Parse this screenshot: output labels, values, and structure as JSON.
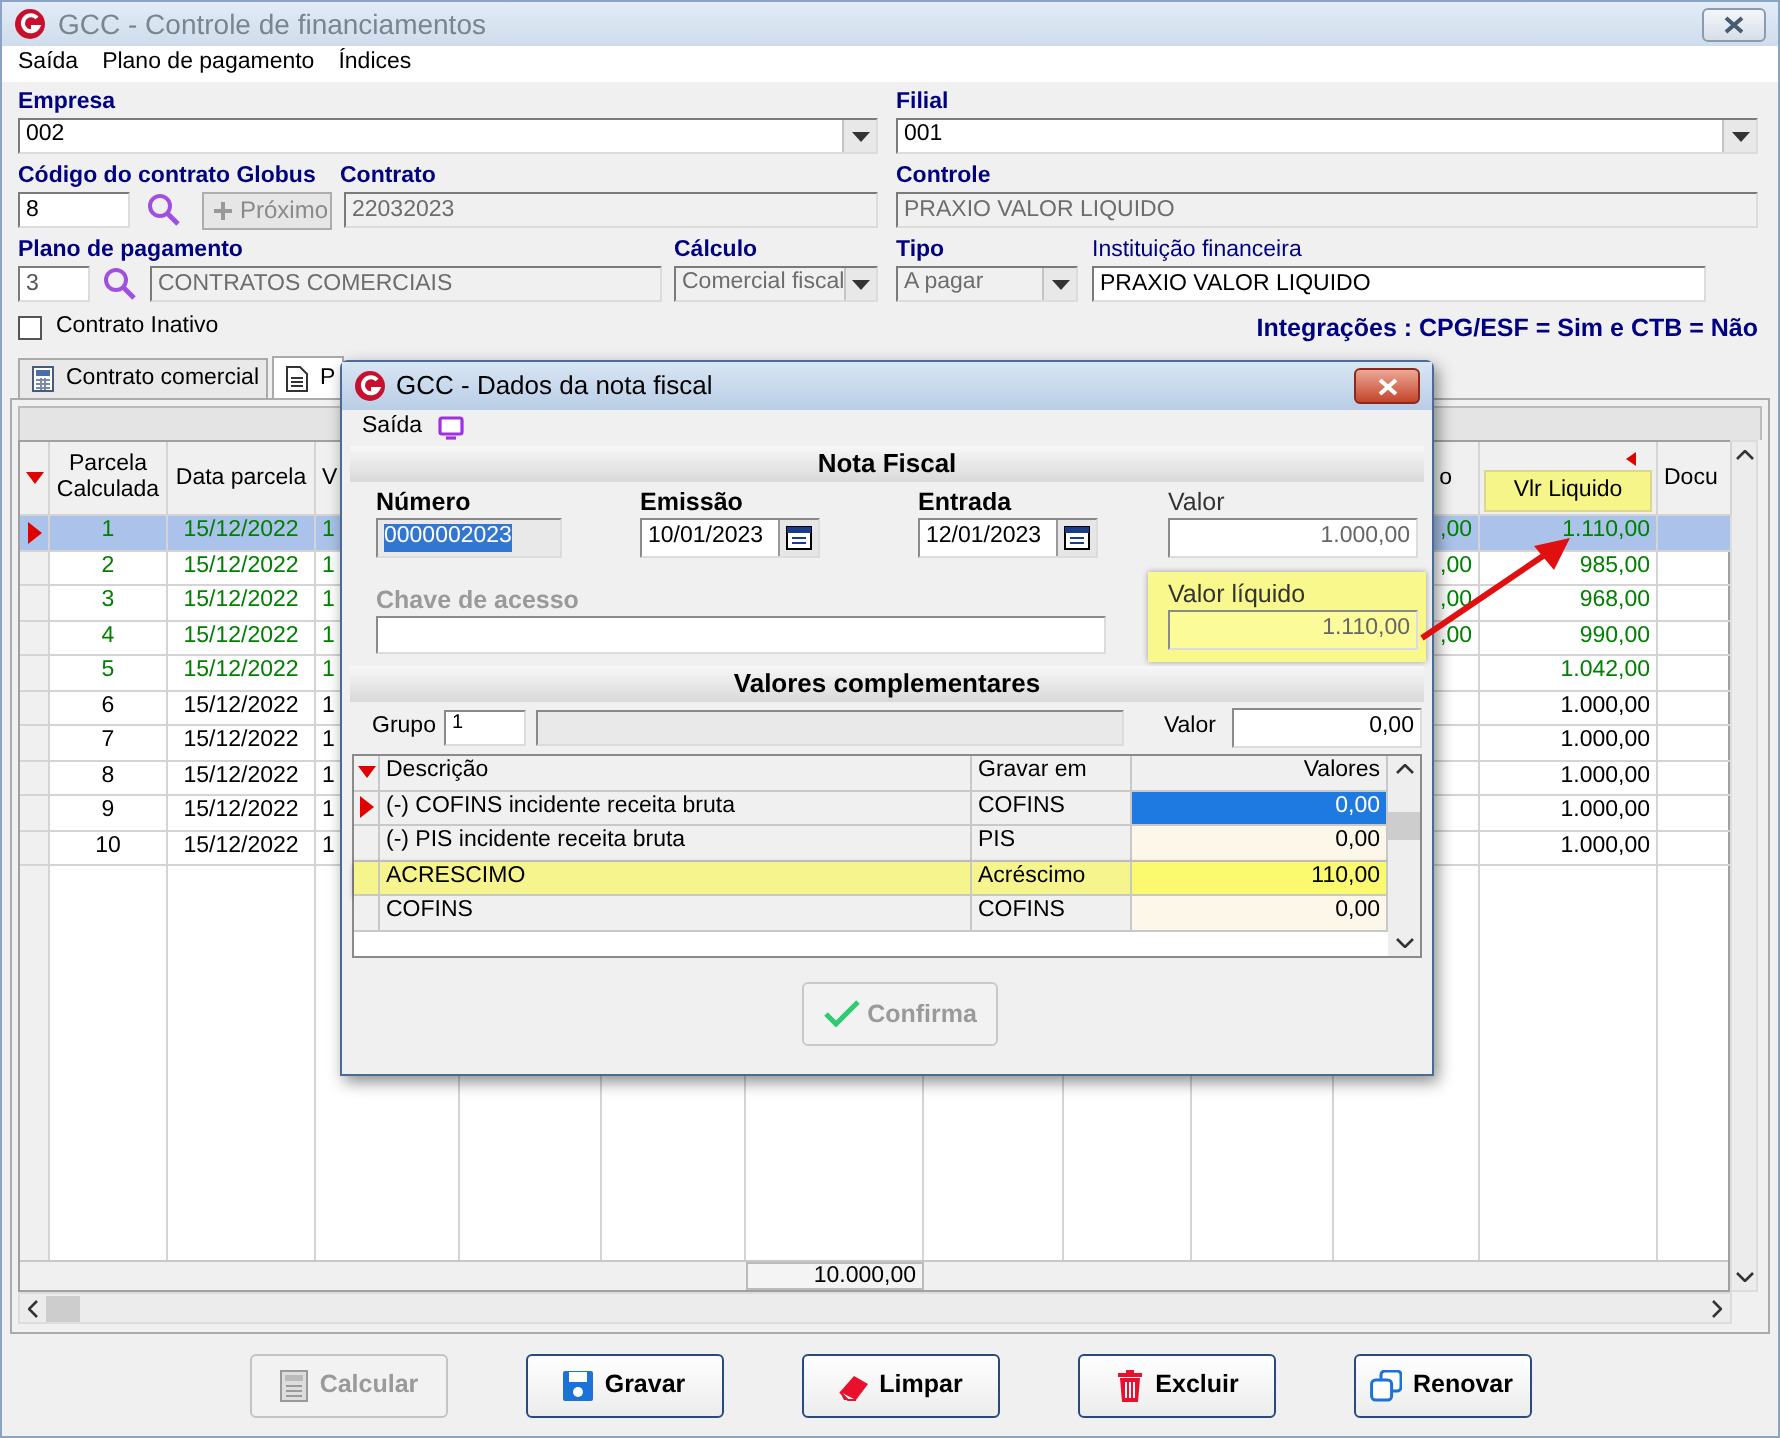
{
  "window": {
    "title": "GCC - Controle de financiamentos"
  },
  "menu": [
    "Saída",
    "Plano de pagamento",
    "Índices"
  ],
  "form": {
    "empresa": {
      "label": "Empresa",
      "value": "002"
    },
    "filial": {
      "label": "Filial",
      "value": "001"
    },
    "codigo": {
      "label": "Código do contrato Globus",
      "value": "8"
    },
    "proximo_button": {
      "label": "Próximo",
      "disabled": true
    },
    "contrato": {
      "label": "Contrato",
      "value": "22032023"
    },
    "controle": {
      "label": "Controle",
      "value": "PRAXIO VALOR LIQUIDO"
    },
    "plano": {
      "label": "Plano de pagamento",
      "code": "3",
      "value": "CONTRATOS COMERCIAIS"
    },
    "calculo": {
      "label": "Cálculo",
      "value": "Comercial fiscal",
      "disabled": true
    },
    "tipo": {
      "label": "Tipo",
      "value": "A pagar",
      "disabled": true
    },
    "instituicao": {
      "label": "Instituição financeira",
      "value": "PRAXIO VALOR LIQUIDO"
    },
    "contrato_inativo": {
      "label": "Contrato Inativo",
      "checked": false
    },
    "integracoes": "Integrações : CPG/ESF = Sim e CTB = Não"
  },
  "tabs": [
    {
      "label": "Contrato comercial",
      "selected": false
    },
    {
      "label": "P",
      "selected": true
    }
  ],
  "grid": {
    "columns": [
      {
        "label": "Parcela Calculada",
        "highlighted": false
      },
      {
        "label": "Data parcela",
        "highlighted": false
      },
      {
        "label": "V",
        "highlighted": false
      },
      {
        "label": "o",
        "highlighted": false
      },
      {
        "label": "Vlr Liquido",
        "highlighted": true
      },
      {
        "label": "Docu",
        "highlighted": false
      }
    ],
    "rows": [
      {
        "parcela": "1",
        "data": "15/12/2022",
        "column_3": "1",
        "column_10": ",00",
        "vlr_liquido": "1.110,00",
        "selected": true,
        "color": "#008000"
      },
      {
        "parcela": "2",
        "data": "15/12/2022",
        "column_3": "1",
        "column_10": ",00",
        "vlr_liquido": "985,00",
        "selected": false,
        "color": "#008000"
      },
      {
        "parcela": "3",
        "data": "15/12/2022",
        "column_3": "1",
        "column_10": ",00",
        "vlr_liquido": "968,00",
        "selected": false,
        "color": "#008000"
      },
      {
        "parcela": "4",
        "data": "15/12/2022",
        "column_3": "1",
        "column_10": ",00",
        "vlr_liquido": "990,00",
        "selected": false,
        "color": "#008000"
      },
      {
        "parcela": "5",
        "data": "15/12/2022",
        "column_3": "1",
        "vlr_liquido": "1.042,00",
        "selected": false,
        "color": "#008000"
      },
      {
        "parcela": "6",
        "data": "15/12/2022",
        "column_3": "1",
        "vlr_liquido": "1.000,00",
        "selected": false,
        "color": "#000000"
      },
      {
        "parcela": "7",
        "data": "15/12/2022",
        "column_3": "1",
        "vlr_liquido": "1.000,00",
        "selected": false,
        "color": "#000000"
      },
      {
        "parcela": "8",
        "data": "15/12/2022",
        "column_3": "1",
        "vlr_liquido": "1.000,00",
        "selected": false,
        "color": "#000000"
      },
      {
        "parcela": "9",
        "data": "15/12/2022",
        "column_3": "1",
        "vlr_liquido": "1.000,00",
        "selected": false,
        "color": "#000000"
      },
      {
        "parcela": "10",
        "data": "15/12/2022",
        "column_3": "1",
        "vlr_liquido": "1.000,00",
        "selected": false,
        "color": "#000000"
      }
    ],
    "total": "10.000,00"
  },
  "dialog": {
    "title": "GCC - Dados da nota fiscal",
    "menu": [
      "Saída"
    ],
    "nota_fiscal": {
      "heading": "Nota Fiscal",
      "numero": {
        "label": "Número",
        "value": "0000002023",
        "text_selected": true
      },
      "emissao": {
        "label": "Emissão",
        "value": "10/01/2023"
      },
      "entrada": {
        "label": "Entrada",
        "value": "12/01/2023"
      },
      "valor": {
        "label": "Valor",
        "value": "1.000,00"
      },
      "chave": {
        "label": "Chave de acesso",
        "disabled": true
      },
      "valor_liquido": {
        "label": "Valor líquido",
        "value": "1.110,00",
        "highlighted": true
      }
    },
    "complementares": {
      "heading": "Valores complementares",
      "grupo": {
        "label": "Grupo",
        "value": "1"
      },
      "valor": {
        "label": "Valor",
        "value": "0,00"
      },
      "columns": [
        "Descrição",
        "Gravar em",
        "Valores"
      ],
      "rows": [
        {
          "descricao": "(-) COFINS incidente receita bruta",
          "gravar_em": "COFINS",
          "valor": "0,00",
          "selected": true,
          "highlighted": false
        },
        {
          "descricao": "(-) PIS incidente receita bruta",
          "gravar_em": "PIS",
          "valor": "0,00",
          "selected": false,
          "highlighted": false
        },
        {
          "descricao": "ACRESCIMO",
          "gravar_em": "Acréscimo",
          "valor": "110,00",
          "selected": false,
          "highlighted": true
        },
        {
          "descricao": "COFINS",
          "gravar_em": "COFINS",
          "valor": "0,00",
          "selected": false,
          "highlighted": false
        }
      ]
    },
    "confirm_button": {
      "label": "Confirma",
      "disabled": true
    }
  },
  "buttons": [
    {
      "label": "Calcular",
      "kind": "calculator",
      "disabled": true
    },
    {
      "label": "Gravar",
      "kind": "save",
      "disabled": false
    },
    {
      "label": "Limpar",
      "kind": "eraser",
      "disabled": false
    },
    {
      "label": "Excluir",
      "kind": "trash",
      "disabled": false
    },
    {
      "label": "Renovar",
      "kind": "copy",
      "disabled": false
    }
  ],
  "annotation": {
    "arrow": true
  }
}
